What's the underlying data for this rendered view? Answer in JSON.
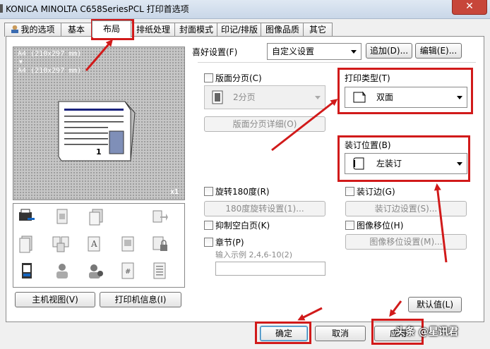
{
  "window": {
    "title": "KONICA MINOLTA C658SeriesPCL 打印首选项",
    "close": "✕"
  },
  "tabs": [
    {
      "label": "我的选项",
      "selected": false
    },
    {
      "label": "基本",
      "selected": false
    },
    {
      "label": "布局",
      "selected": true
    },
    {
      "label": "排纸处理",
      "selected": false
    },
    {
      "label": "封面模式",
      "selected": false
    },
    {
      "label": "印记/排版",
      "selected": false
    },
    {
      "label": "图像品质",
      "selected": false
    },
    {
      "label": "其它",
      "selected": false
    }
  ],
  "preview": {
    "line1": "A4 (210x297 mm)",
    "arrow": "▼",
    "line2": "A4 (210x297 mm)",
    "page_number": "1",
    "count": "x1"
  },
  "left_buttons": {
    "host_view": "主机视图(V)",
    "printer_info": "打印机信息(I)"
  },
  "favorites": {
    "label": "喜好设置(F)",
    "value": "自定义设置",
    "add": "追加(D)...",
    "edit": "编辑(E)..."
  },
  "combination": {
    "label": "版面分页(C)",
    "value": "2分页",
    "details": "版面分页详细(O)"
  },
  "print_type": {
    "label": "打印类型(T)",
    "value": "双面"
  },
  "binding": {
    "label": "装订位置(B)",
    "value": "左装订"
  },
  "rotate": {
    "label": "旋转180度(R)",
    "settings": "180度旋转设置(1)..."
  },
  "gutter": {
    "label": "装订边(G)",
    "settings": "装订边设置(S)..."
  },
  "skip_blank": {
    "label": "抑制空白页(K)"
  },
  "image_shift": {
    "label": "图像移位(H)",
    "settings": "图像移位设置(M)..."
  },
  "chapter": {
    "label": "章节(P)",
    "hint": "输入示例 2,4,6-10(2)"
  },
  "defaults": {
    "label": "默认值(L)"
  },
  "footer": {
    "ok": "确定",
    "cancel": "取消",
    "apply": "应用"
  },
  "watermark": "头条 @星讯君",
  "colors": {
    "annotation": "#d11a1a",
    "preview_bg": "#c6c6c6",
    "title_bar": "#cdd9e9",
    "close": "#c7463a"
  }
}
